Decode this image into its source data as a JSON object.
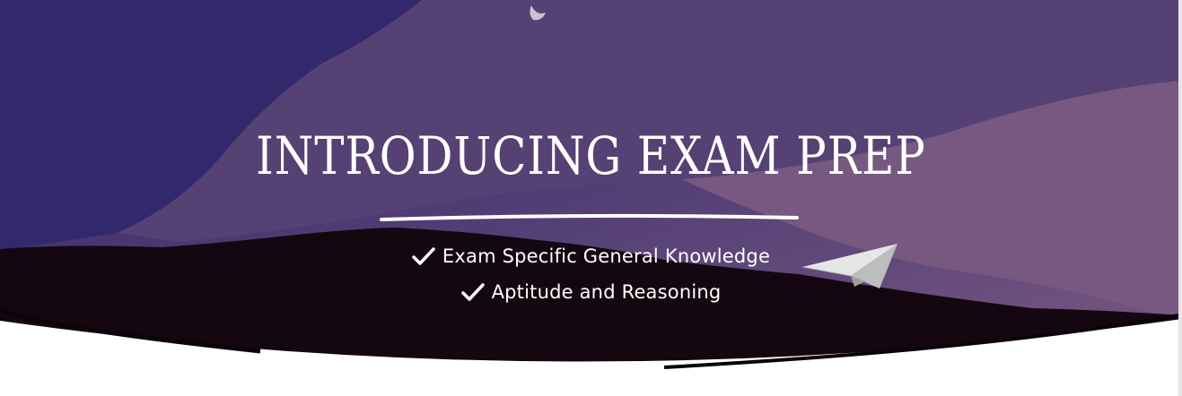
{
  "hero": {
    "title": "INTRODUCING EXAM PREP",
    "bullets": [
      {
        "label": "Exam Specific General Knowledge",
        "icon": "check-icon"
      },
      {
        "label": "Aptitude and Reasoning",
        "icon": "check-icon"
      }
    ],
    "decorations": [
      "moon-icon",
      "paper-plane-icon",
      "mountain-silhouette"
    ],
    "colors": {
      "sky_dark": "#35296a",
      "sky_mid": "#554075",
      "sky_light": "#7a5a80",
      "mountain": "#15070f",
      "text": "#ffffff"
    }
  }
}
